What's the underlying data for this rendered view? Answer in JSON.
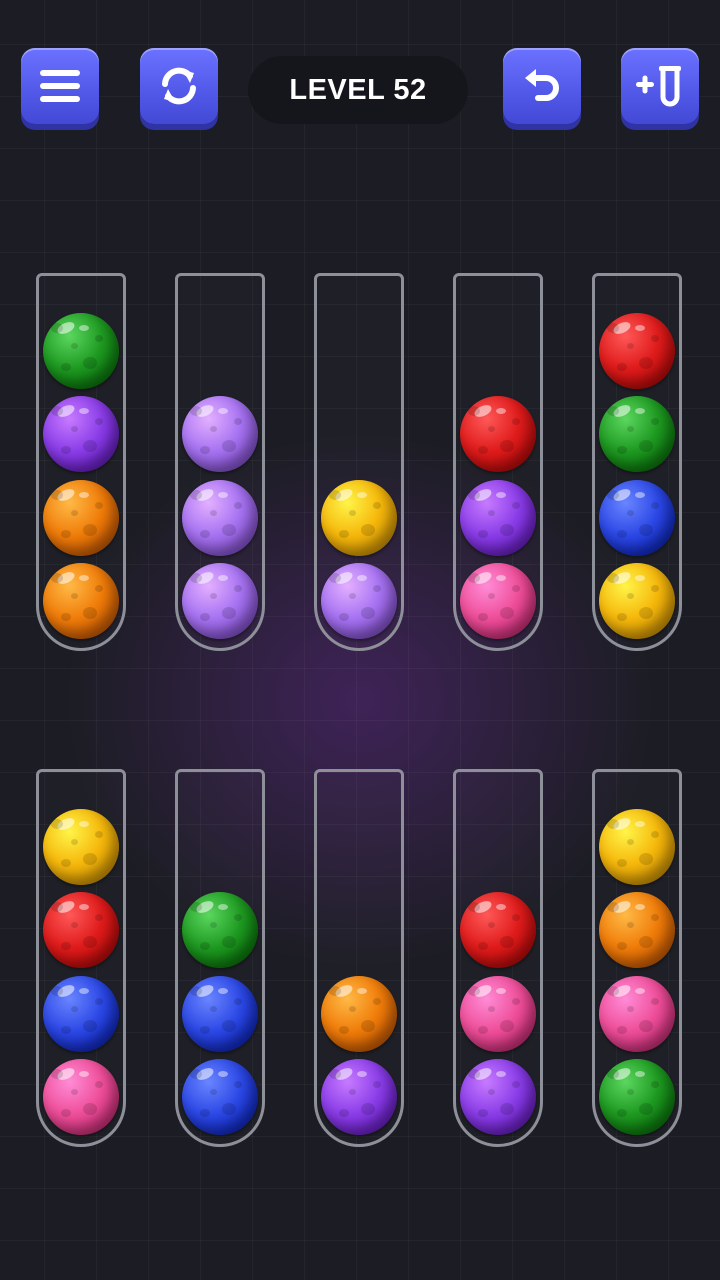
{
  "header": {
    "level_label": "LEVEL 52"
  },
  "buttons": [
    {
      "name": "menu-button",
      "icon": "menu-icon"
    },
    {
      "name": "restart-button",
      "icon": "restart-icon"
    },
    {
      "name": "undo-button",
      "icon": "undo-icon"
    },
    {
      "name": "add-tube-button",
      "icon": "add-tube-icon"
    }
  ],
  "colors": {
    "green": "#1f9a22",
    "purple": "#8b3ee8",
    "orange": "#f07d0a",
    "lavender": "#a773f2",
    "yellow": "#f6b80c",
    "red": "#e01c1c",
    "pink": "#ef4f9a",
    "blue": "#2d49e6",
    "button": "#5a60f2",
    "tube_border": "#8d8f99"
  },
  "tubes_top": [
    [
      "green",
      "purple",
      "orange",
      "orange"
    ],
    [
      "lavender",
      "lavender",
      "lavender"
    ],
    [
      "yellow",
      "lavender"
    ],
    [
      "red",
      "purple",
      "pink"
    ],
    [
      "red",
      "green",
      "blue",
      "yellow"
    ]
  ],
  "tubes_bottom": [
    [
      "yellow",
      "red",
      "blue",
      "pink"
    ],
    [
      "green",
      "blue",
      "blue"
    ],
    [
      "orange",
      "purple"
    ],
    [
      "red",
      "pink",
      "purple"
    ],
    [
      "yellow",
      "orange",
      "pink",
      "green"
    ]
  ]
}
